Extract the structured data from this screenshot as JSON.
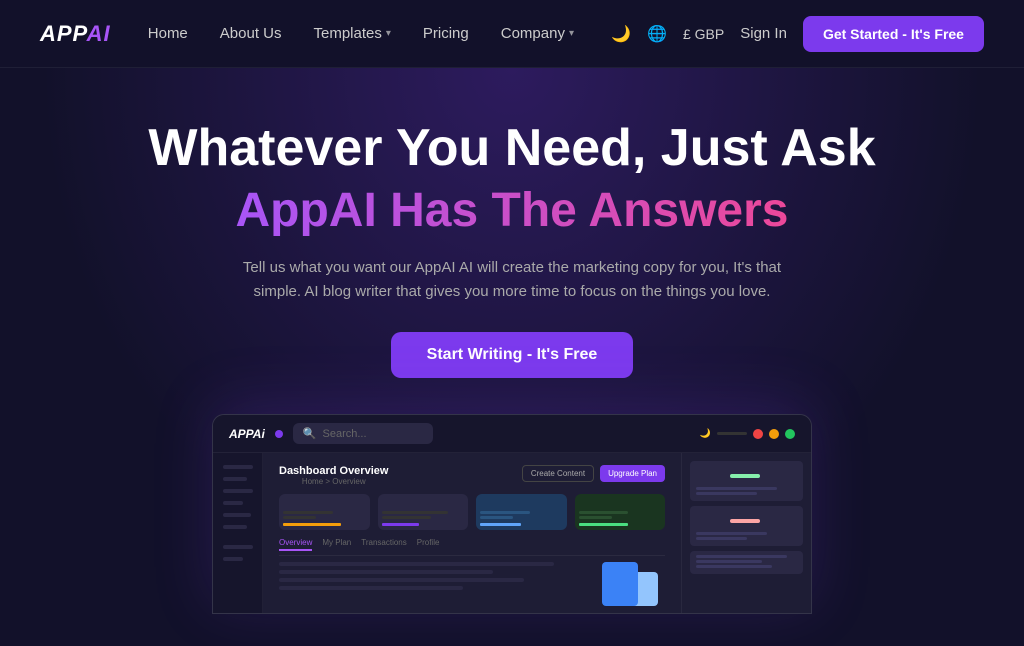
{
  "logo": {
    "text": "APPAI",
    "accent": "AI"
  },
  "nav": {
    "links": [
      {
        "label": "Home",
        "hasDropdown": false
      },
      {
        "label": "About Us",
        "hasDropdown": false
      },
      {
        "label": "Templates",
        "hasDropdown": true
      },
      {
        "label": "Pricing",
        "hasDropdown": false
      },
      {
        "label": "Company",
        "hasDropdown": true
      }
    ],
    "currency": "£ GBP",
    "signIn": "Sign In",
    "getStarted": "Get Started - It's Free"
  },
  "hero": {
    "heading1": "Whatever You Need, Just Ask",
    "heading2": "AppAI Has The Answers",
    "description": "Tell us what you want our AppAI AI will create the marketing copy for you, It's that simple. AI blog writer that gives you more time to focus on the things you love.",
    "cta": "Start Writing - It's Free"
  },
  "dashboard": {
    "logo": "APPAi",
    "searchPlaceholder": "Search...",
    "title": "Dashboard Overview",
    "breadcrumb": "Home > Overview",
    "createContent": "Create Content",
    "upgradePlan": "Upgrade Plan",
    "tabs": [
      "Overview",
      "My Plan",
      "Transactions",
      "Profile"
    ]
  }
}
